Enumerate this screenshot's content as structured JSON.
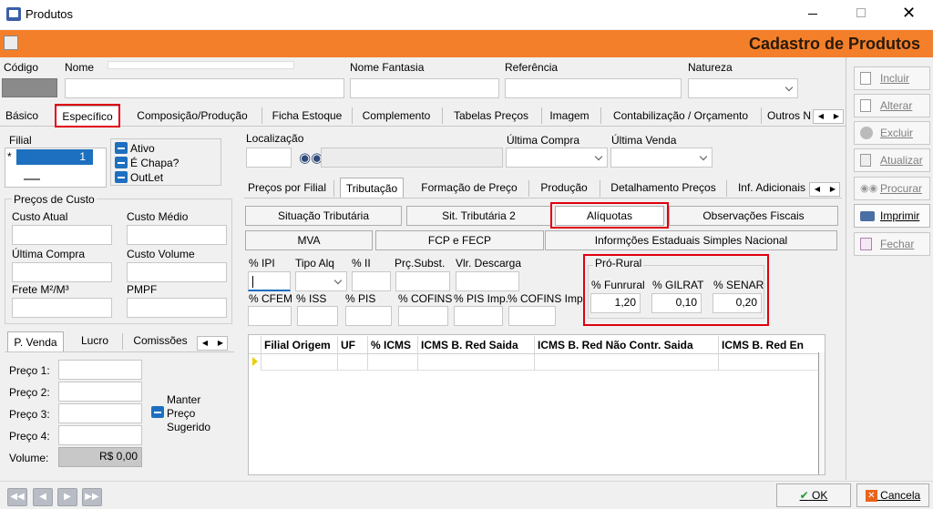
{
  "window": {
    "title": "Produtos",
    "banner_title": "Cadastro de Produtos"
  },
  "colors": {
    "banner": "#f47f2a",
    "accent_blue": "#1d6fbf",
    "highlight_red": "#e0000e"
  },
  "header_fields": {
    "codigo_label": "Código",
    "nome_label": "Nome",
    "nome_fantasia_label": "Nome Fantasia",
    "referencia_label": "Referência",
    "natureza_label": "Natureza"
  },
  "main_tabs": [
    "Básico",
    "Específico",
    "Composição/Produção",
    "Ficha Estoque",
    "Complemento",
    "Tabelas Preços",
    "Imagem",
    "Contabilização / Orçamento",
    "Outros N"
  ],
  "filial": {
    "label": "Filial",
    "row_marker": "*",
    "value": "1"
  },
  "checkboxes": [
    "Ativo",
    "É Chapa?",
    "OutLet"
  ],
  "precos_custo": {
    "group_label": "Preços de Custo",
    "custo_atual": "Custo Atual",
    "custo_medio": "Custo Médio",
    "ultima_compra": "Última Compra",
    "custo_volume": "Custo Volume",
    "frete": "Frete M²/M³",
    "pmpf": "PMPF"
  },
  "localizacao": {
    "label": "Localização",
    "binoculars_icon": "binoculars-icon"
  },
  "ultima_compra_label": "Última Compra",
  "ultima_venda_label": "Última Venda",
  "sub_tabs": [
    "Preços por Filial",
    "Tributação",
    "Formação de Preço",
    "Produção",
    "Detalhamento Preços",
    "Inf. Adicionais"
  ],
  "trib_buttons": {
    "situacao": "Situação Tributária",
    "sit2": "Sit. Tributária 2",
    "aliquotas": "Alíquotas",
    "obs": "Observações Fiscais",
    "mva": "MVA",
    "fcp": "FCP e FECP",
    "estaduais": "Informções Estaduais Simples Nacional"
  },
  "aliquotas_fields": {
    "ipi": "% IPI",
    "tipo_alq": "Tipo Alq",
    "ii": "% II",
    "prc_subst": "Prç.Subst.",
    "vlr_descarga": "Vlr. Descarga",
    "cfem": "% CFEM",
    "iss": "% ISS",
    "pis": "% PIS",
    "cofins": "% COFINS",
    "pis_imp": "% PIS Imp.",
    "cofins_imp": "% COFINS Imp."
  },
  "pro_rural": {
    "group_label": "Pró-Rural",
    "funrural_label": "% Funrural",
    "funrural_value": "1,20",
    "gilrat_label": "% GILRAT",
    "gilrat_value": "0,10",
    "senar_label": "% SENAR",
    "senar_value": "0,20"
  },
  "grid_columns": [
    "Filial Origem",
    "UF",
    "% ICMS",
    "ICMS B. Red Saida",
    "ICMS B. Red Não Contr. Saida",
    "ICMS B. Red En"
  ],
  "venda_tabs": [
    "P. Venda",
    "Lucro",
    "Comissões"
  ],
  "precos_venda": {
    "preco1": "Preço 1:",
    "preco2": "Preço 2:",
    "preco3": "Preço 3:",
    "preco4": "Preço 4:",
    "volume_label": "Volume:",
    "volume_value": "R$ 0,00",
    "manter_label": "Manter Preço Sugerido"
  },
  "side_buttons": {
    "incluir": "Incluir",
    "alterar": "Alterar",
    "excluir": "Excluir",
    "atualizar": "Atualizar",
    "procurar": "Procurar",
    "imprimir": "Imprimir",
    "fechar": "Fechar"
  },
  "footer": {
    "ok": "OK",
    "cancela": "Cancela"
  }
}
